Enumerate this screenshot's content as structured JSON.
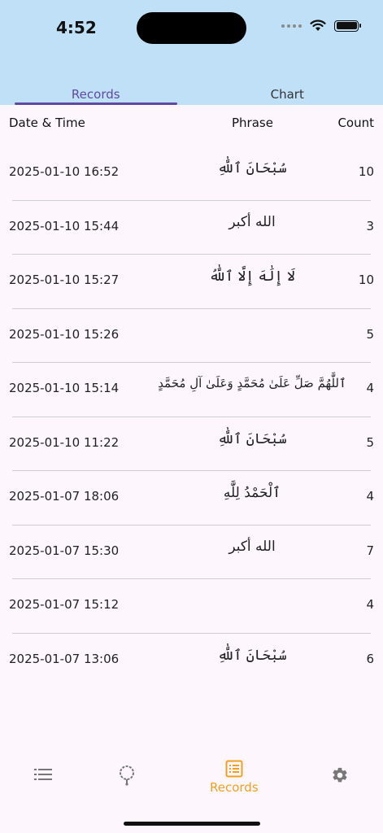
{
  "status": {
    "time": "4:52"
  },
  "tabs": [
    {
      "label": "Records",
      "active": true
    },
    {
      "label": "Chart",
      "active": false
    }
  ],
  "table": {
    "headers": {
      "datetime": "Date & Time",
      "phrase": "Phrase",
      "count": "Count"
    },
    "rows": [
      {
        "datetime": "2025-01-10 16:52",
        "phrase": "سُبْحَانَ ٱللَّٰهِ",
        "count": "10"
      },
      {
        "datetime": "2025-01-10 15:44",
        "phrase": "الله أكبر",
        "count": "3"
      },
      {
        "datetime": "2025-01-10 15:27",
        "phrase": "لَا إِلَٰهَ إِلَّا ٱللَّٰهُ",
        "count": "10"
      },
      {
        "datetime": "2025-01-10 15:26",
        "phrase": "",
        "count": "5"
      },
      {
        "datetime": "2025-01-10 15:14",
        "phrase": "ٱللَّٰهُمَّ صَلِّ عَلَىٰ مُحَمَّدٍ وَعَلَىٰ آلِ مُحَمَّدٍ",
        "count": "4"
      },
      {
        "datetime": "2025-01-10 11:22",
        "phrase": "سُبْحَانَ ٱللَّٰهِ",
        "count": "5"
      },
      {
        "datetime": "2025-01-07 18:06",
        "phrase": "ٱلْحَمْدُ لِلَّٰهِ",
        "count": "4"
      },
      {
        "datetime": "2025-01-07 15:30",
        "phrase": "الله أكبر",
        "count": "7"
      },
      {
        "datetime": "2025-01-07 15:12",
        "phrase": "",
        "count": "4"
      },
      {
        "datetime": "2025-01-07 13:06",
        "phrase": "سُبْحَانَ ٱللَّٰهِ",
        "count": "6"
      }
    ]
  },
  "nav": {
    "items": [
      {
        "icon": "list-icon"
      },
      {
        "icon": "beads-icon"
      },
      {
        "icon": "records-icon",
        "label": "Records",
        "active": true
      },
      {
        "icon": "settings-icon"
      }
    ],
    "active_color": "#f0a020"
  },
  "colors": {
    "header_bg": "#bfe0f7",
    "accent": "#5e4aa3",
    "page_bg": "#fdf7fd"
  }
}
